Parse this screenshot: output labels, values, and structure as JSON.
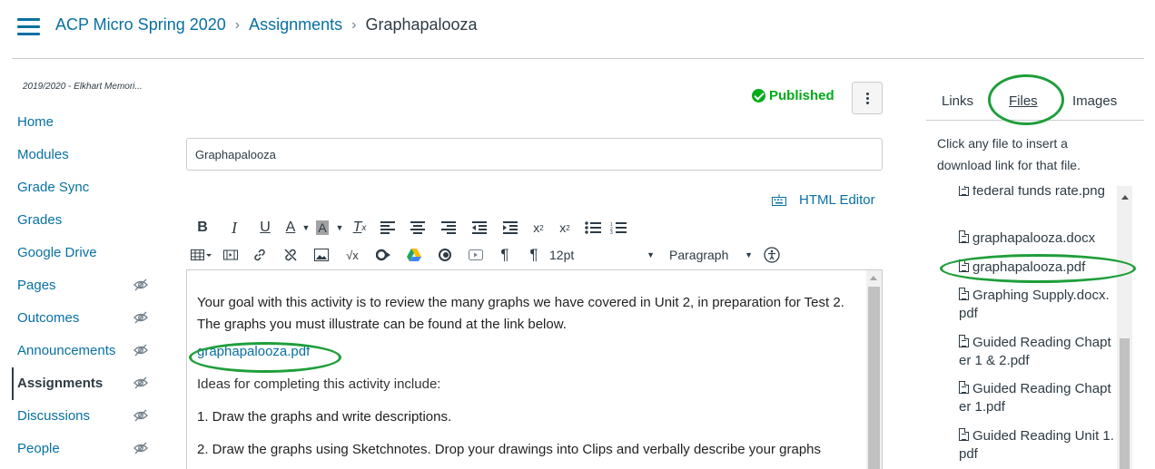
{
  "header": {
    "breadcrumb": [
      "ACP Micro Spring 2020",
      "Assignments",
      "Graphapalooza"
    ]
  },
  "sidebar": {
    "school": "2019/2020 - Elkhart Memori...",
    "items": [
      {
        "label": "Home",
        "hidden": false
      },
      {
        "label": "Modules",
        "hidden": false
      },
      {
        "label": "Grade Sync",
        "hidden": false
      },
      {
        "label": "Grades",
        "hidden": false
      },
      {
        "label": "Google Drive",
        "hidden": false
      },
      {
        "label": "Pages",
        "hidden": true
      },
      {
        "label": "Outcomes",
        "hidden": true
      },
      {
        "label": "Announcements",
        "hidden": true
      },
      {
        "label": "Assignments",
        "hidden": true,
        "active": true
      },
      {
        "label": "Discussions",
        "hidden": true
      },
      {
        "label": "People",
        "hidden": true
      }
    ]
  },
  "main": {
    "status": "Published",
    "title_value": "Graphapalooza",
    "html_editor_label": "HTML Editor",
    "toolbar": {
      "font_size": "12pt",
      "block_format": "Paragraph"
    },
    "content": {
      "intro": "Your goal with this activity is to review the many graphs we have covered in Unit 2, in preparation for Test 2.  The graphs you must illustrate can be found  at the link below.",
      "link": "graphapalooza.pdf",
      "ideas": "Ideas for completing this activity include:",
      "item1": "1. Draw the graphs and write descriptions.",
      "item2": "2. Draw the graphs using Sketchnotes.  Drop your drawings into Clips and verbally describe your graphs"
    }
  },
  "right_panel": {
    "tabs": [
      "Links",
      "Files",
      "Images"
    ],
    "active_tab": "Files",
    "description": "Click any file to insert a download link for that file.",
    "files": [
      "federal funds rate.png",
      "graphapalooza.docx",
      "graphapalooza.pdf",
      "Graphing Supply.docx.pdf",
      "Guided Reading Chapter 1 & 2.pdf",
      "Guided Reading Chapter 1.pdf",
      "Guided Reading Unit 1.pdf"
    ]
  },
  "colors": {
    "link": "#0770a3",
    "published": "#00ac18",
    "annotation": "#1e9e3a",
    "text": "#2d3b45"
  }
}
